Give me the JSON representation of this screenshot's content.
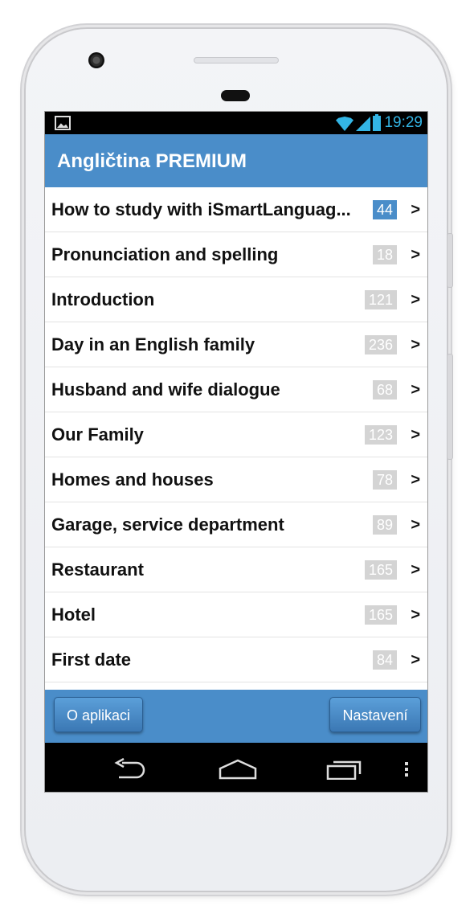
{
  "status_bar": {
    "time": "19:29",
    "accent_color": "#33b5e5"
  },
  "header": {
    "title": "Angličtina PREMIUM",
    "color": "#4a8dc9"
  },
  "items": [
    {
      "label": "How to study with iSmartLanguag...",
      "count": "44",
      "active": true
    },
    {
      "label": "Pronunciation and spelling",
      "count": "18"
    },
    {
      "label": "Introduction",
      "count": "121"
    },
    {
      "label": "Day in an English family",
      "count": "236"
    },
    {
      "label": "Husband and wife dialogue",
      "count": "68"
    },
    {
      "label": "Our Family",
      "count": "123"
    },
    {
      "label": "Homes and houses",
      "count": "78"
    },
    {
      "label": "Garage, service department",
      "count": "89"
    },
    {
      "label": "Restaurant",
      "count": "165"
    },
    {
      "label": "Hotel",
      "count": "165"
    },
    {
      "label": "First date",
      "count": "84"
    }
  ],
  "chevron": ">",
  "footer": {
    "about_label": "O aplikaci",
    "settings_label": "Nastavení"
  }
}
